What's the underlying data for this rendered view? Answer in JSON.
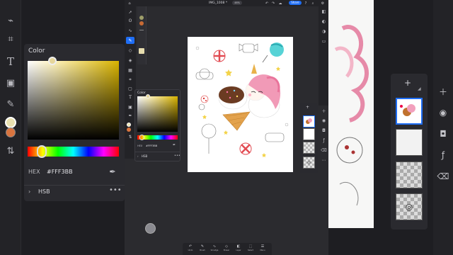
{
  "app": {
    "document_title": "IMG_1008 *",
    "zoom_label": "46%",
    "share_label": "Share"
  },
  "color_panel": {
    "title": "Color",
    "hex_label": "HEX",
    "hex_value": "#FFF3BB",
    "mode_label": "HSB",
    "more_label": "•••",
    "expand_label": "›"
  },
  "color_popover": {
    "title": "Color",
    "hex_label": "HEX",
    "hex_value": "#FFF3BB",
    "mode_label": "HSB",
    "more_label": "•••",
    "expand_label": "›"
  },
  "colors": {
    "primary": "#FFF3BB",
    "secondary": "#D9743F",
    "accent": "#1F6EF5"
  },
  "bottom_bar": {
    "items": [
      {
        "label": "Undo",
        "icon": "undo-icon"
      },
      {
        "label": "Brush",
        "icon": "brush-icon"
      },
      {
        "label": "Smudge",
        "icon": "smudge-icon"
      },
      {
        "label": "Eraser",
        "icon": "eraser-icon"
      },
      {
        "label": "Layer",
        "icon": "layer-icon"
      },
      {
        "label": "Select",
        "icon": "select-icon"
      },
      {
        "label": "Menu",
        "icon": "menu-icon"
      }
    ]
  },
  "layers_panel": {
    "add_label": "+"
  }
}
